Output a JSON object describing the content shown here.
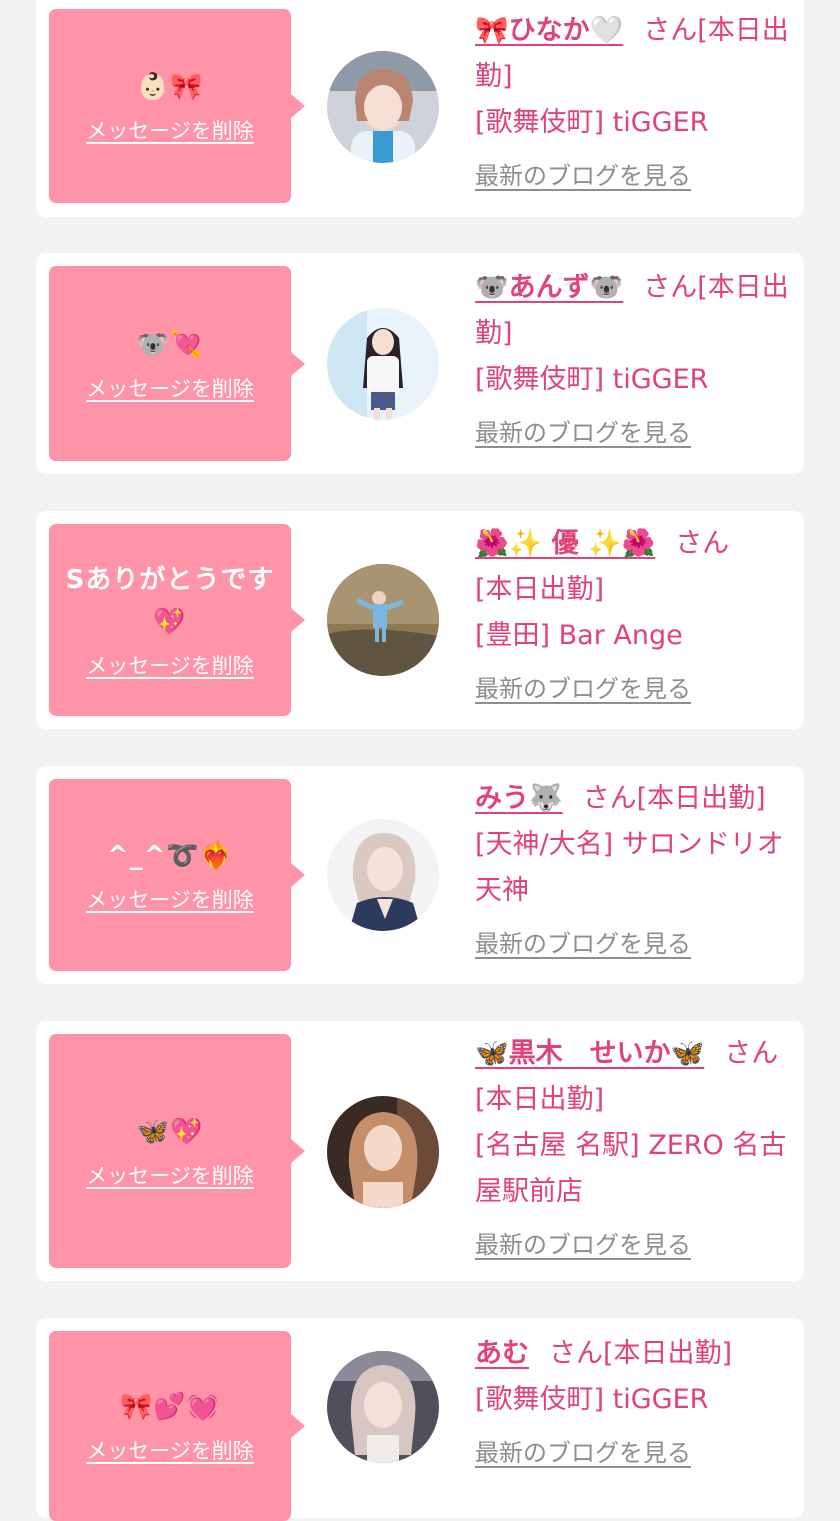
{
  "ui": {
    "delete_label": "メッセージを削除",
    "blog_label": "最新のブログを見る",
    "san_label": "さん",
    "colors": {
      "background": "#f2f2f4",
      "card": "#ffffff",
      "bubble": "#ff93a8",
      "accent": "#e0427a",
      "link_gray": "#8e8e8e"
    }
  },
  "cards": [
    {
      "message": "👶🏻🎀",
      "name": "🎀ひなか🤍",
      "status": "[本日出勤]",
      "shop": "[歌舞伎町] tiGGER"
    },
    {
      "message": "🐨💘",
      "name": "🐨あんず🐨",
      "status": "[本日出勤]",
      "shop": "[歌舞伎町] tiGGER"
    },
    {
      "message": "Sありがとうです💖",
      "name": "🌺✨ 優 ✨🌺",
      "status": "[本日出勤]",
      "shop": "[豊田] Bar Ange"
    },
    {
      "message": "^_^➰❤️‍🔥",
      "name": "みう🐺",
      "status": "[本日出勤]",
      "shop": "[天神/大名] サロンドリオ 天神"
    },
    {
      "message": "🦋💖",
      "name": "🦋黒木　せいか🦋",
      "status": "[本日出勤]",
      "shop": "[名古屋 名駅] ZERO 名古屋駅前店"
    },
    {
      "message": "🎀💕💓",
      "name": "あむ",
      "status": "[本日出勤]",
      "shop": "[歌舞伎町] tiGGER"
    }
  ]
}
